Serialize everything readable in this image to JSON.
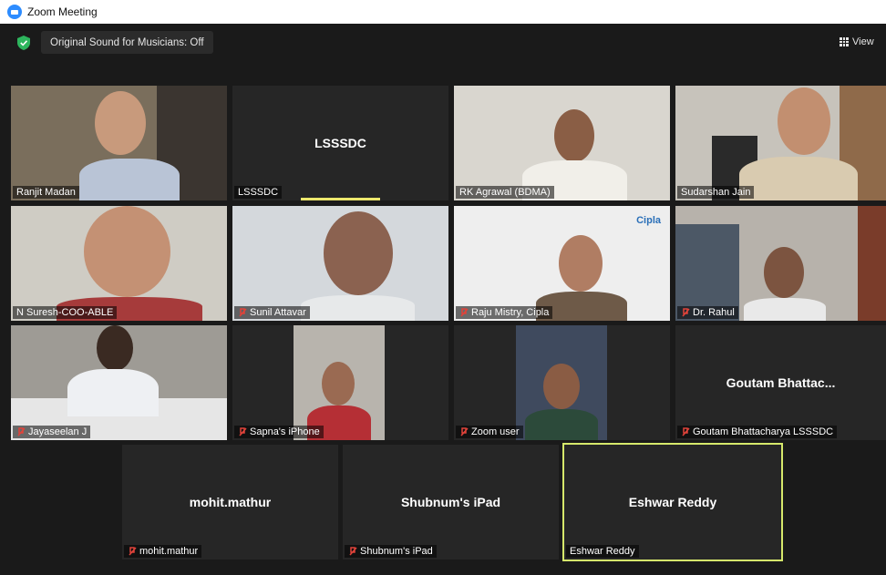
{
  "window": {
    "title": "Zoom Meeting"
  },
  "toolbar": {
    "sound_label": "Original Sound for Musicians: Off",
    "view_label": "View"
  },
  "participants": [
    {
      "name": "Ranjit Madan",
      "muted": false,
      "video": true
    },
    {
      "name": "LSSSDC",
      "display_name": "LSSSDC",
      "muted": false,
      "video": false
    },
    {
      "name": "RK Agrawal (BDMA)",
      "muted": false,
      "video": true
    },
    {
      "name": "Sudarshan Jain",
      "muted": false,
      "video": true
    },
    {
      "name": "N Suresh-COO-ABLE",
      "muted": false,
      "video": true
    },
    {
      "name": "Sunil Attavar",
      "muted": true,
      "video": true
    },
    {
      "name": "Raju Mistry, Cipla",
      "muted": true,
      "video": true,
      "brand": "Cipla"
    },
    {
      "name": "Dr. Rahul",
      "muted": true,
      "video": true
    },
    {
      "name": "Jayaseelan J",
      "muted": true,
      "video": true
    },
    {
      "name": "Sapna's iPhone",
      "muted": true,
      "video": true
    },
    {
      "name": "Zoom user",
      "muted": true,
      "video": true
    },
    {
      "name": "Goutam Bhattacharya LSSSDC",
      "display_name": "Goutam  Bhattac...",
      "muted": true,
      "video": false
    },
    {
      "name": "mohit.mathur",
      "display_name": "mohit.mathur",
      "muted": true,
      "video": false
    },
    {
      "name": "Shubnum's iPad",
      "display_name": "Shubnum's iPad",
      "muted": true,
      "video": false
    },
    {
      "name": "Eshwar Reddy",
      "display_name": "Eshwar Reddy",
      "muted": false,
      "video": false,
      "active_speaker": true
    }
  ],
  "colors": {
    "speaker_highlight": "#d6e86b",
    "muted_icon": "#e0433a",
    "security_green": "#2db55d"
  }
}
